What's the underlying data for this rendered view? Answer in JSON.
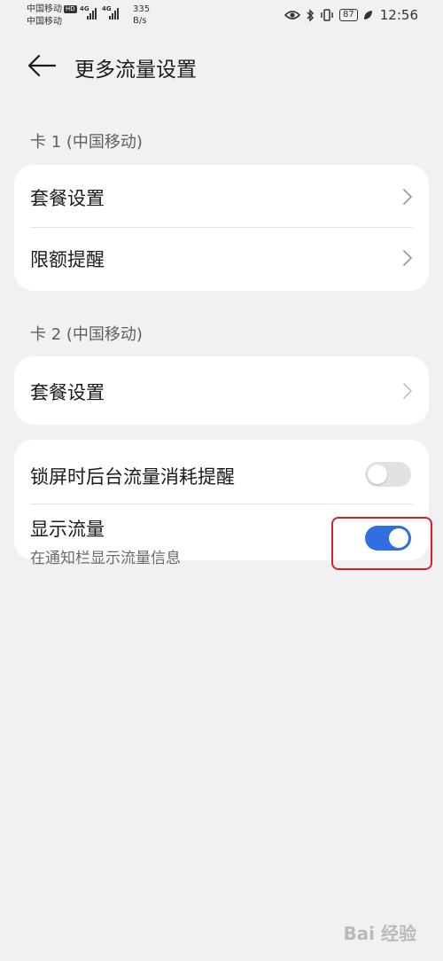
{
  "status_bar": {
    "carrier_1": "中国移动",
    "hd_badge": "HD",
    "carrier_2": "中国移动",
    "net_type_1": "4G",
    "net_type_2": "4G",
    "speed_value": "335",
    "speed_unit": "B/s",
    "battery": "87",
    "time": "12:56"
  },
  "header": {
    "title": "更多流量设置"
  },
  "sim1": {
    "section_label": "卡 1 (中国移动)",
    "items": [
      {
        "label": "套餐设置"
      },
      {
        "label": "限额提醒"
      }
    ]
  },
  "sim2": {
    "section_label": "卡 2 (中国移动)",
    "items": [
      {
        "label": "套餐设置"
      }
    ]
  },
  "toggles": {
    "lockscreen_reminder": {
      "label": "锁屏时后台流量消耗提醒",
      "enabled": false
    },
    "show_traffic": {
      "label": "显示流量",
      "sublabel": "在通知栏显示流量信息",
      "enabled": true
    }
  },
  "colors": {
    "accent": "#2f6fe0",
    "highlight": "#d2232a",
    "background": "#f1f1f3"
  },
  "watermark": "Bai 经验"
}
